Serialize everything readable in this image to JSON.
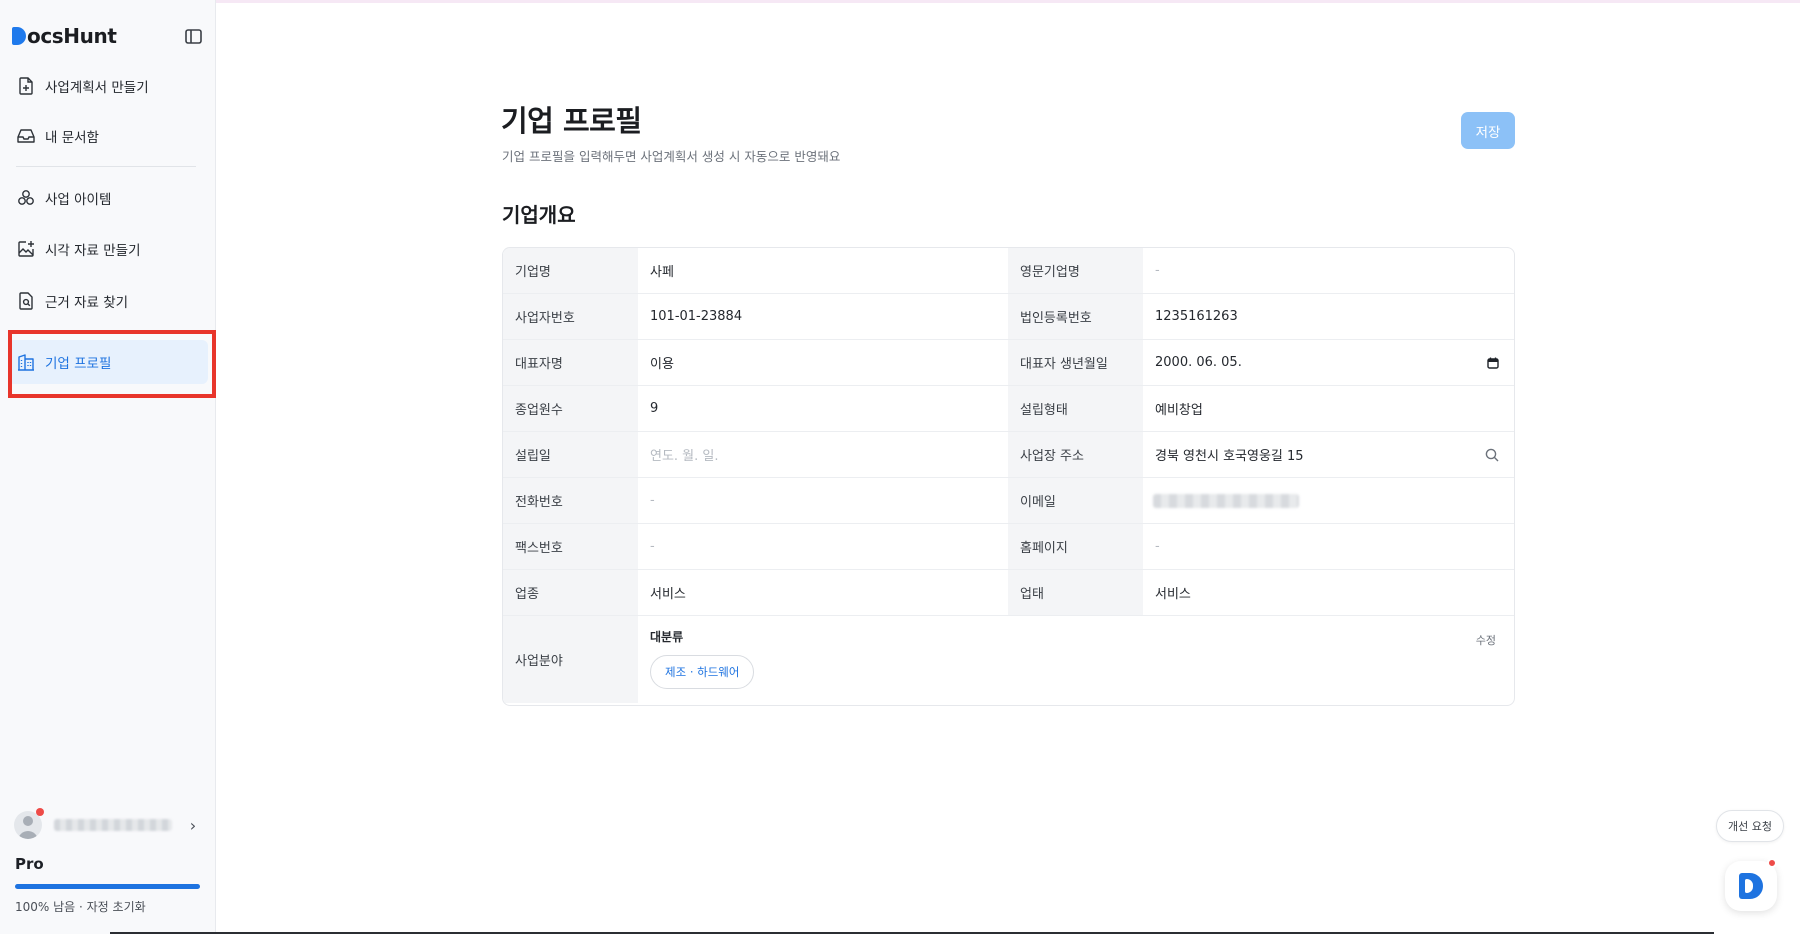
{
  "app": {
    "logo_text": "ocsHunt",
    "brand_color": "#1e73e0"
  },
  "sidebar": {
    "items": [
      {
        "label": "사업계획서 만들기",
        "icon": "file-plus-icon"
      },
      {
        "label": "내 문서함",
        "icon": "inbox-icon"
      },
      {
        "label": "사업 아이템",
        "icon": "items-icon"
      },
      {
        "label": "시각 자료 만들기",
        "icon": "image-plus-icon"
      },
      {
        "label": "근거 자료 찾기",
        "icon": "file-search-icon"
      },
      {
        "label": "기업 프로필",
        "icon": "building-icon",
        "active": true
      }
    ],
    "plan": "Pro",
    "plan_usage_percent": 100,
    "plan_note": "100% 남음 · 자정 초기화"
  },
  "page": {
    "title": "기업 프로필",
    "subtitle": "기업 프로필을 입력해두면 사업계획서 생성 시 자동으로 반영돼요",
    "save_label": "저장",
    "section_title": "기업개요"
  },
  "profile": {
    "rows": [
      {
        "label_left": "기업명",
        "value_left": "사페",
        "label_right": "영문기업명",
        "value_right": "-"
      },
      {
        "label_left": "사업자번호",
        "value_left": "101-01-23884",
        "label_right": "법인등록번호",
        "value_right": "1235161263"
      },
      {
        "label_left": "대표자명",
        "value_left": "이용",
        "label_right": "대표자 생년월일",
        "value_right": "2000. 06. 05."
      },
      {
        "label_left": "종업원수",
        "value_left": "9",
        "label_right": "설립형태",
        "value_right": "예비창업"
      },
      {
        "label_left": "설립일",
        "value_left": "연도. 월. 일.",
        "label_right": "사업장 주소",
        "value_right": "경북 영천시 호국영웅길 15"
      },
      {
        "label_left": "전화번호",
        "value_left": "-",
        "label_right": "이메일",
        "value_right": ""
      },
      {
        "label_left": "팩스번호",
        "value_left": "-",
        "label_right": "홈페이지",
        "value_right": "-"
      },
      {
        "label_left": "업종",
        "value_left": "서비스",
        "label_right": "업태",
        "value_right": "서비스"
      }
    ],
    "business_field": {
      "label": "사업분야",
      "category_label": "대분류",
      "edit_label": "수정",
      "chip": "제조 · 하드웨어"
    }
  },
  "floating": {
    "feedback_label": "개선 요청"
  }
}
